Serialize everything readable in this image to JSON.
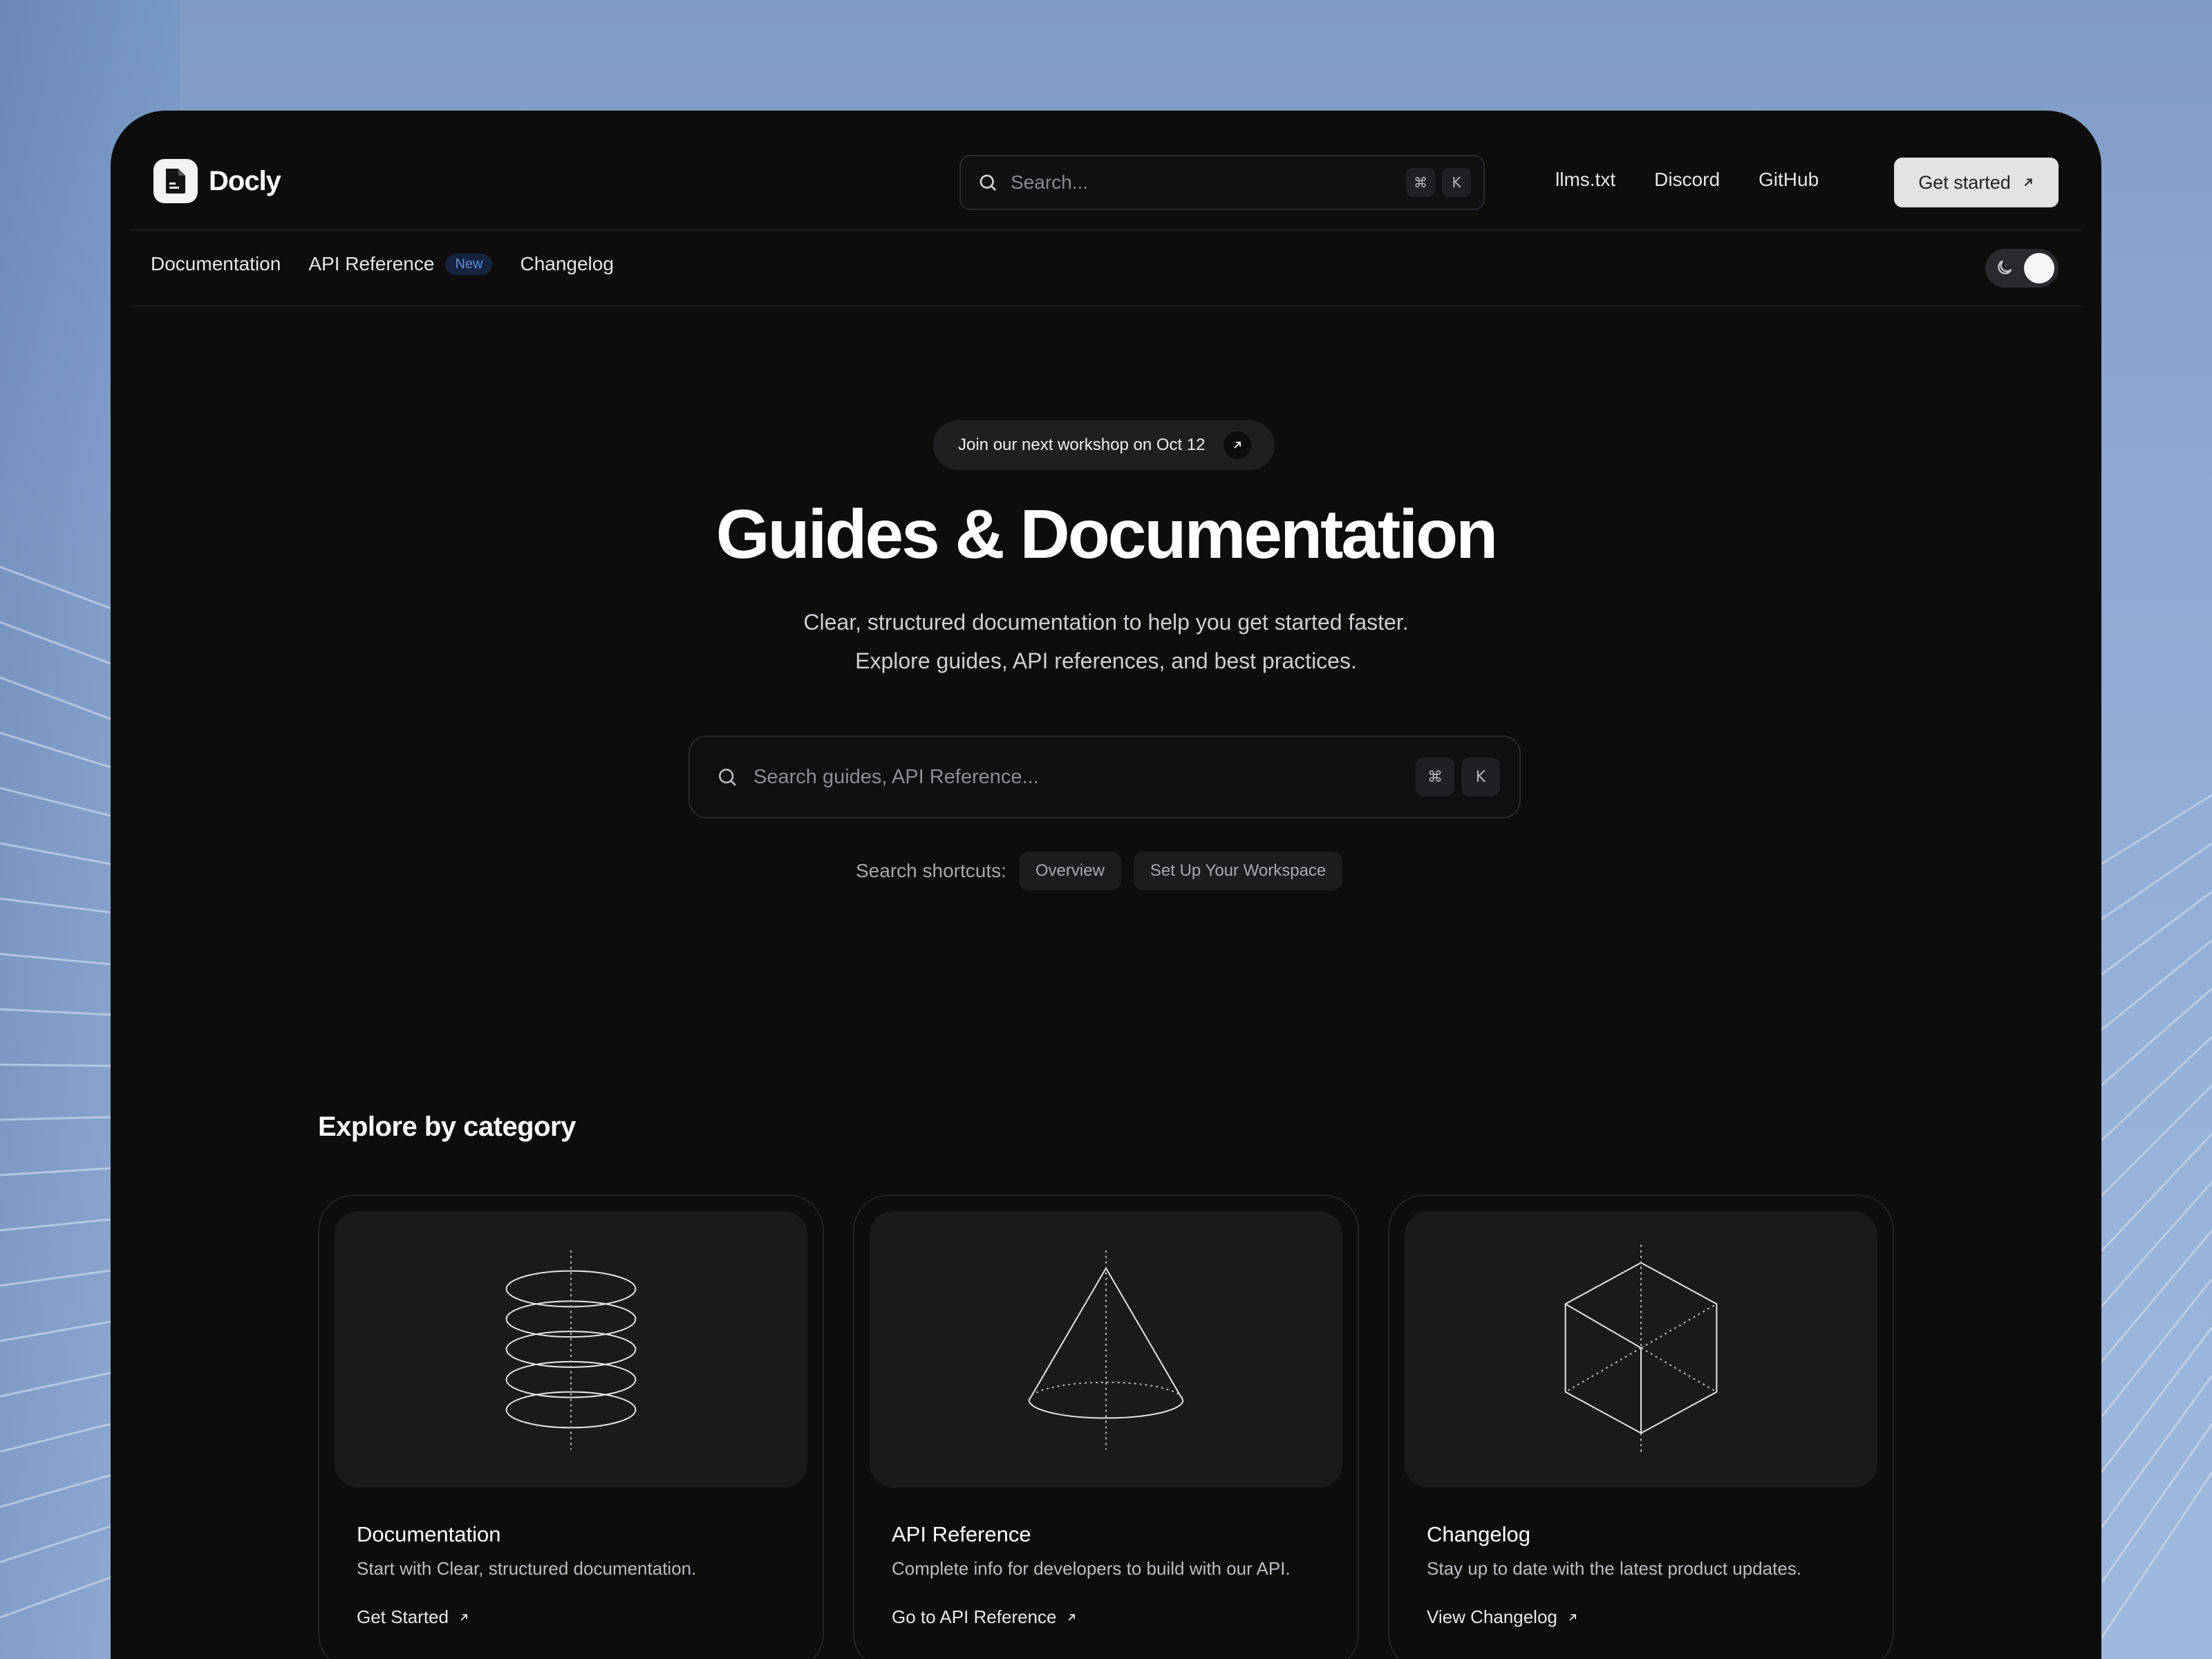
{
  "brand": {
    "name": "Docly"
  },
  "header": {
    "search_placeholder": "Search...",
    "shortcut_keys": [
      "⌘",
      "K"
    ],
    "links": [
      "llms.txt",
      "Discord",
      "GitHub"
    ],
    "cta_label": "Get started"
  },
  "subnav": {
    "items": [
      {
        "label": "Documentation"
      },
      {
        "label": "API Reference",
        "badge": "New"
      },
      {
        "label": "Changelog"
      }
    ],
    "theme_toggle": "dark"
  },
  "hero": {
    "announcement": "Join our next workshop on Oct 12",
    "title": "Guides & Documentation",
    "subtitle_line1": "Clear, structured documentation to help you get started faster.",
    "subtitle_line2": "Explore guides, API references, and best practices.",
    "search_placeholder": "Search guides, API Reference...",
    "shortcut_keys": [
      "⌘",
      "K"
    ],
    "shortcuts_label": "Search shortcuts:",
    "shortcuts": [
      "Overview",
      "Set Up Your Workspace"
    ]
  },
  "categories": {
    "title": "Explore by category",
    "cards": [
      {
        "title": "Documentation",
        "description": "Start with Clear, structured documentation.",
        "link": "Get Started",
        "icon": "stacked-discs-icon"
      },
      {
        "title": "API Reference",
        "description": "Complete info for developers to build with our API.",
        "link": "Go to API Reference",
        "icon": "cone-icon"
      },
      {
        "title": "Changelog",
        "description": "Stay up to date with the latest product updates.",
        "link": "View Changelog",
        "icon": "cube-icon"
      }
    ]
  },
  "colors": {
    "window_bg": "#0d0d0e",
    "card_art_bg": "#1a1a1b",
    "badge_text": "#5d8fe0",
    "cta_bg": "#e3e3e6"
  }
}
